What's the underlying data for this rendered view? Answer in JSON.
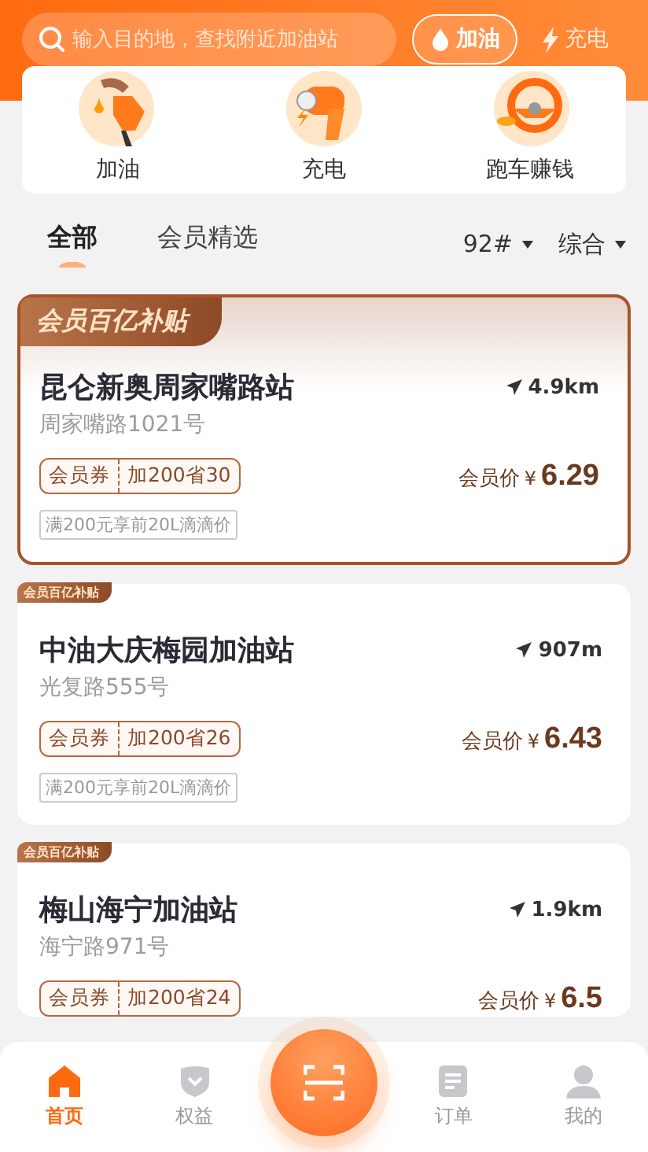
{
  "search": {
    "placeholder": "输入目的地，查找附近加油站"
  },
  "fuel_switch": [
    {
      "label": "加油",
      "selected": true,
      "kind": "drop"
    },
    {
      "label": "充电",
      "selected": false,
      "kind": "bolt"
    }
  ],
  "shortcuts": [
    {
      "label": "加油",
      "kind": "fuel"
    },
    {
      "label": "充电",
      "kind": "charge"
    },
    {
      "label": "跑车赚钱",
      "kind": "wheel"
    }
  ],
  "tabs": [
    {
      "label": "全部",
      "selected": true
    },
    {
      "label": "会员精选",
      "selected": false
    }
  ],
  "filters": [
    {
      "label": "92#"
    },
    {
      "label": "综合"
    }
  ],
  "stations": [
    {
      "badge": "会员百亿补贴",
      "featured": true,
      "name": "昆仑新奥周家嘴路站",
      "distance": "4.9km",
      "address": "周家嘴路1021号",
      "coupon_tag": "会员券",
      "coupon": "加200省30",
      "price_label": "会员价",
      "currency": "¥",
      "price": "6.29",
      "note": "满200元享前20L滴滴价"
    },
    {
      "badge": "会员百亿补贴",
      "featured": false,
      "name": "中油大庆梅园加油站",
      "distance": "907m",
      "address": "光复路555号",
      "coupon_tag": "会员券",
      "coupon": "加200省26",
      "price_label": "会员价",
      "currency": "¥",
      "price": "6.43",
      "note": "满200元享前20L滴滴价"
    },
    {
      "badge": "会员百亿补贴",
      "featured": false,
      "name": "梅山海宁加油站",
      "distance": "1.9km",
      "address": "海宁路971号",
      "coupon_tag": "会员券",
      "coupon": "加200省24",
      "price_label": "会员价",
      "currency": "¥",
      "price": "6.5"
    }
  ],
  "nav": [
    {
      "label": "首页",
      "selected": true,
      "kind": "home"
    },
    {
      "label": "权益",
      "selected": false,
      "kind": "shield"
    },
    {
      "label": "订单",
      "selected": false,
      "kind": "doc"
    },
    {
      "label": "我的",
      "selected": false,
      "kind": "person"
    }
  ]
}
